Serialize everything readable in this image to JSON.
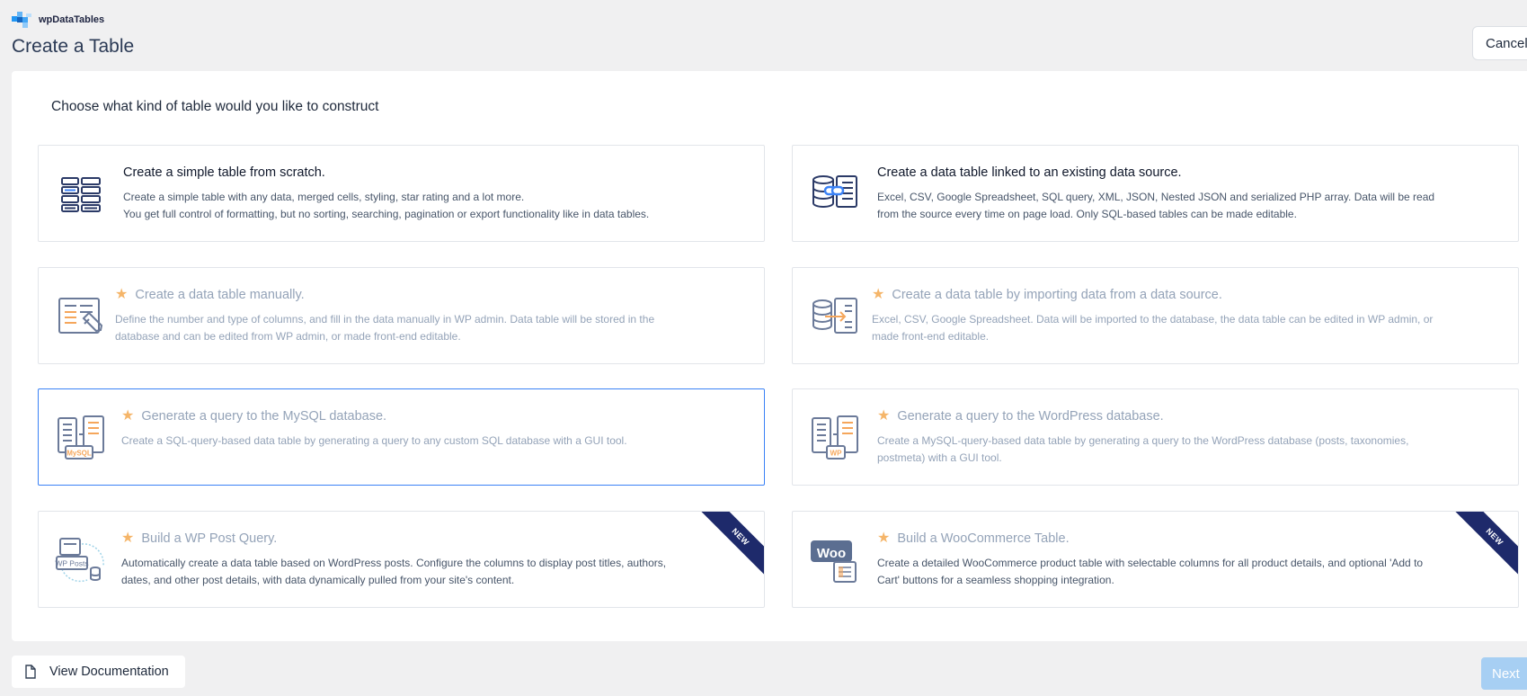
{
  "brand": {
    "name": "wpDataTables",
    "logo_icon": "wpdatatables-logo-icon"
  },
  "page": {
    "title": "Create a Table"
  },
  "header": {
    "cancel_label": "Cancel"
  },
  "panel": {
    "heading": "Choose what kind of table would you like to construct"
  },
  "cards": [
    {
      "title": "Create a simple table from scratch.",
      "lines": [
        "Create a simple table with any data, merged cells, styling, star rating and a lot more.",
        "You get full control of formatting, but no sorting, searching, pagination or export functionality like in data tables."
      ],
      "premium": false,
      "badge": "",
      "icon": "simple-table-icon"
    },
    {
      "title": "Create a data table linked to an existing data source.",
      "lines": [
        "Excel, CSV, Google Spreadsheet, SQL query, XML, JSON, Nested JSON and serialized PHP array. Data will be read",
        "from the source every time on page load. Only SQL-based tables can be made editable."
      ],
      "premium": false,
      "badge": "",
      "icon": "linked-data-source-icon"
    },
    {
      "title": "Create a data table manually.",
      "lines": [
        "Define the number and type of columns, and fill in the data manually in WP admin. Data table will be stored in the",
        "database and can be edited from WP admin, or made front-end editable."
      ],
      "premium": true,
      "badge": "",
      "icon": "manual-table-icon"
    },
    {
      "title": "Create a data table by importing data from a data source.",
      "lines": [
        "Excel, CSV, Google Spreadsheet. Data will be imported to the database, the data table can be edited in WP admin, or",
        "made front-end editable."
      ],
      "premium": true,
      "badge": "",
      "icon": "import-data-icon"
    },
    {
      "title": "Generate a query to the MySQL database.",
      "lines": [
        "Create a SQL-query-based data table by generating a query to any custom SQL database with a GUI tool."
      ],
      "premium": true,
      "badge": "",
      "icon": "mysql-query-icon",
      "icon_label": "MySQL"
    },
    {
      "title": "Generate a query to the WordPress database.",
      "lines": [
        "Create a MySQL-query-based data table by generating a query to the WordPress database (posts, taxonomies,",
        "postmeta) with a GUI tool."
      ],
      "premium": true,
      "badge": "",
      "icon": "wordpress-query-icon",
      "icon_label": "WP"
    },
    {
      "title": "Build a WP Post Query.",
      "lines": [
        "Automatically create a data table based on WordPress posts. Configure the columns to display post titles, authors,",
        "dates, and other post details, with data dynamically pulled from your site's content."
      ],
      "premium": true,
      "badge": "NEW",
      "icon": "wp-posts-icon",
      "icon_label": "WP Posts"
    },
    {
      "title": "Build a WooCommerce Table.",
      "lines": [
        "Create a detailed WooCommerce product table with selectable columns for all product details, and optional 'Add to",
        "Cart' buttons for a seamless shopping integration."
      ],
      "premium": true,
      "badge": "NEW",
      "icon": "woocommerce-icon",
      "icon_label": "Woo"
    }
  ],
  "footer": {
    "doc_label": "View Documentation",
    "doc_icon": "document-icon",
    "next_label": "Next"
  },
  "colors": {
    "accent": "#3b82f6",
    "star": "#f5b569",
    "ribbon": "#1e2a6b",
    "next_disabled": "#a7cff3",
    "icon_stroke": "#2b3a67",
    "icon_orange": "#f5a65b"
  }
}
